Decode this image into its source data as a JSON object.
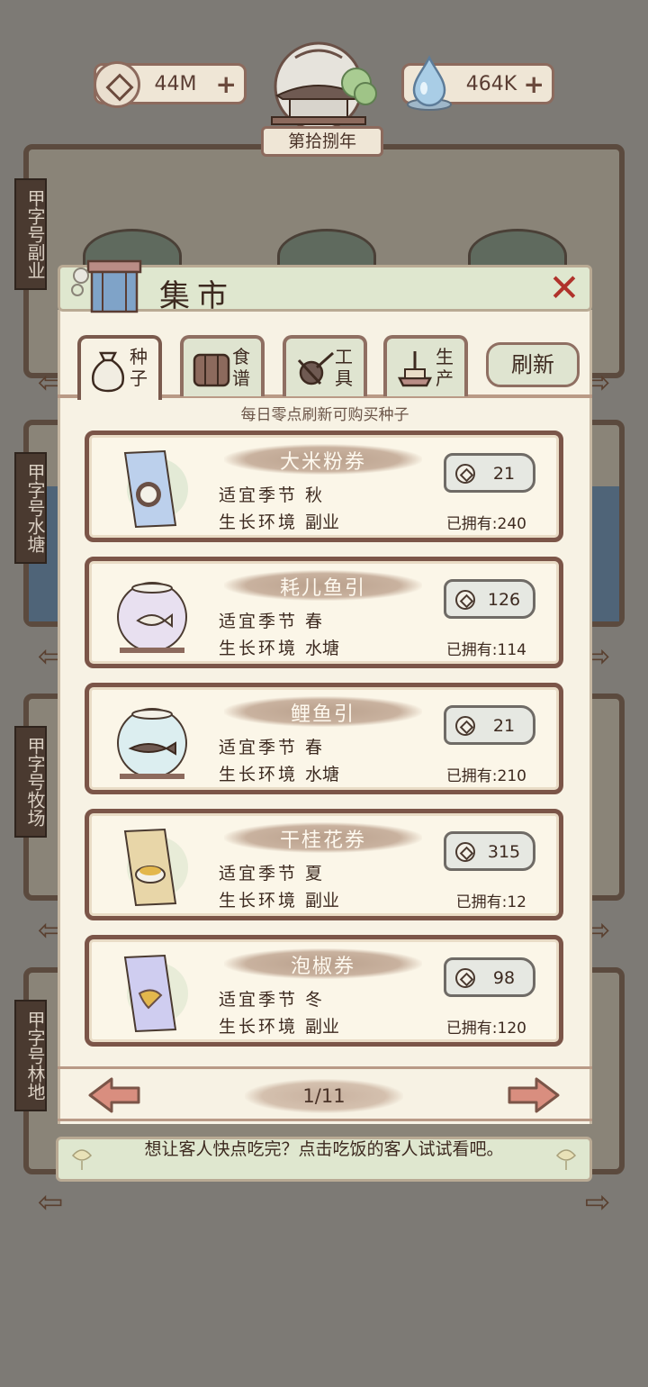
{
  "hud": {
    "coins": "44M",
    "gems": "464K",
    "year": "第拾捌年",
    "plus": "+"
  },
  "side_signs": [
    "甲字号副业",
    "甲字号水塘",
    "甲字号牧场",
    "甲字号林地"
  ],
  "market": {
    "title": "集市",
    "close": "✕",
    "tabs": [
      {
        "label": "种子",
        "icon": "seed-bag-icon"
      },
      {
        "label": "食谱",
        "icon": "recipe-book-icon"
      },
      {
        "label": "工具",
        "icon": "tools-icon"
      },
      {
        "label": "生产",
        "icon": "production-icon"
      }
    ],
    "refresh": "刷新",
    "hint": "每日零点刷新可购买种子",
    "season_label": "适宜季节",
    "env_label": "生长环境",
    "owned_label": "已拥有:",
    "items": [
      {
        "name": "大米粉券",
        "season": "秋",
        "env": "副业",
        "price": "21",
        "owned": "240",
        "icon": "rice-flour-voucher-icon"
      },
      {
        "name": "耗儿鱼引",
        "season": "春",
        "env": "水塘",
        "price": "126",
        "owned": "114",
        "icon": "fish-bowl-icon"
      },
      {
        "name": "鲤鱼引",
        "season": "春",
        "env": "水塘",
        "price": "21",
        "owned": "210",
        "icon": "carp-bowl-icon"
      },
      {
        "name": "干桂花券",
        "season": "夏",
        "env": "副业",
        "price": "315",
        "owned": "12",
        "icon": "osmanthus-voucher-icon"
      },
      {
        "name": "泡椒券",
        "season": "冬",
        "env": "副业",
        "price": "98",
        "owned": "120",
        "icon": "pickled-pepper-voucher-icon"
      }
    ],
    "page": "1/11"
  },
  "tip": "想让客人快点吃完？点击吃饭的客人试试看吧。",
  "colors": {
    "frame": "#7b5548",
    "panel": "#f7f2e4",
    "header": "#dfe7cf",
    "close": "#b0322b"
  }
}
